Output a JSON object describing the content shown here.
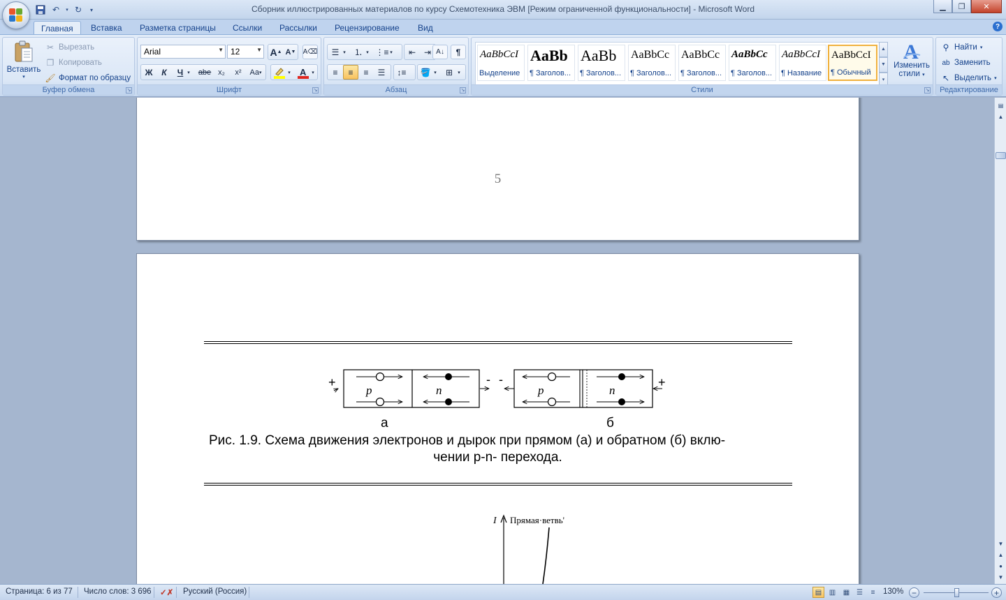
{
  "window": {
    "title": "Сборник иллюстрированных материалов по курсу Схемотехника ЭВМ [Режим ограниченной функциональности] - Microsoft Word"
  },
  "ribbon": {
    "tabs": [
      {
        "label": "Главная",
        "active": true
      },
      {
        "label": "Вставка"
      },
      {
        "label": "Разметка страницы"
      },
      {
        "label": "Ссылки"
      },
      {
        "label": "Рассылки"
      },
      {
        "label": "Рецензирование"
      },
      {
        "label": "Вид"
      }
    ],
    "clipboard": {
      "group_label": "Буфер обмена",
      "paste": "Вставить",
      "cut": "Вырезать",
      "copy": "Копировать",
      "format_painter": "Формат по образцу"
    },
    "font": {
      "group_label": "Шрифт",
      "font_name": "Arial",
      "font_size": "12",
      "bold": "Ж",
      "italic": "К",
      "underline": "Ч",
      "strike": "abe",
      "subscript": "x₂",
      "superscript": "x²",
      "case": "Aa",
      "grow": "A",
      "shrink": "A",
      "font_color_hex": "#e0261f",
      "highlight_hex": "#ffff00"
    },
    "paragraph": {
      "group_label": "Абзац",
      "pilcrow": "¶"
    },
    "styles": {
      "group_label": "Стили",
      "tiles": [
        {
          "sample": "AaBbCcI",
          "name": "Выделение"
        },
        {
          "sample": "AaBb",
          "name": "¶ Заголов..."
        },
        {
          "sample": "AaBb",
          "name": "¶ Заголов..."
        },
        {
          "sample": "AaBbCc",
          "name": "¶ Заголов..."
        },
        {
          "sample": "AaBbCc",
          "name": "¶ Заголов..."
        },
        {
          "sample": "AaBbCc",
          "name": "¶ Заголов..."
        },
        {
          "sample": "AaBbCcI",
          "name": "¶ Название"
        },
        {
          "sample": "AaBbCcI",
          "name": "¶ Обычный",
          "selected": true
        }
      ],
      "change_styles_line1": "Изменить",
      "change_styles_line2": "стили"
    },
    "editing": {
      "group_label": "Редактирование",
      "find": "Найти",
      "replace": "Заменить",
      "select": "Выделить"
    }
  },
  "document": {
    "page_number": "5",
    "figure": {
      "left_sign": "+",
      "mid_sign_1": "-",
      "mid_sign_2": "-",
      "right_sign": "+",
      "region_p": "p",
      "region_n": "n",
      "label_a": "а",
      "label_b": "б",
      "caption_line1": "Рис. 1.9. Схема движения электронов и дырок при прямом (а) и обратном (б) вклю-",
      "caption_line2": "чении p-n- перехода."
    },
    "graph": {
      "axis_label": "I",
      "branch_label": "Прямая·ветвь'"
    }
  },
  "statusbar": {
    "page": "Страница: 6 из 77",
    "words": "Число слов: 3 696",
    "language": "Русский (Россия)",
    "zoom": "130%",
    "zoom_minus": "−",
    "zoom_plus": "+"
  }
}
